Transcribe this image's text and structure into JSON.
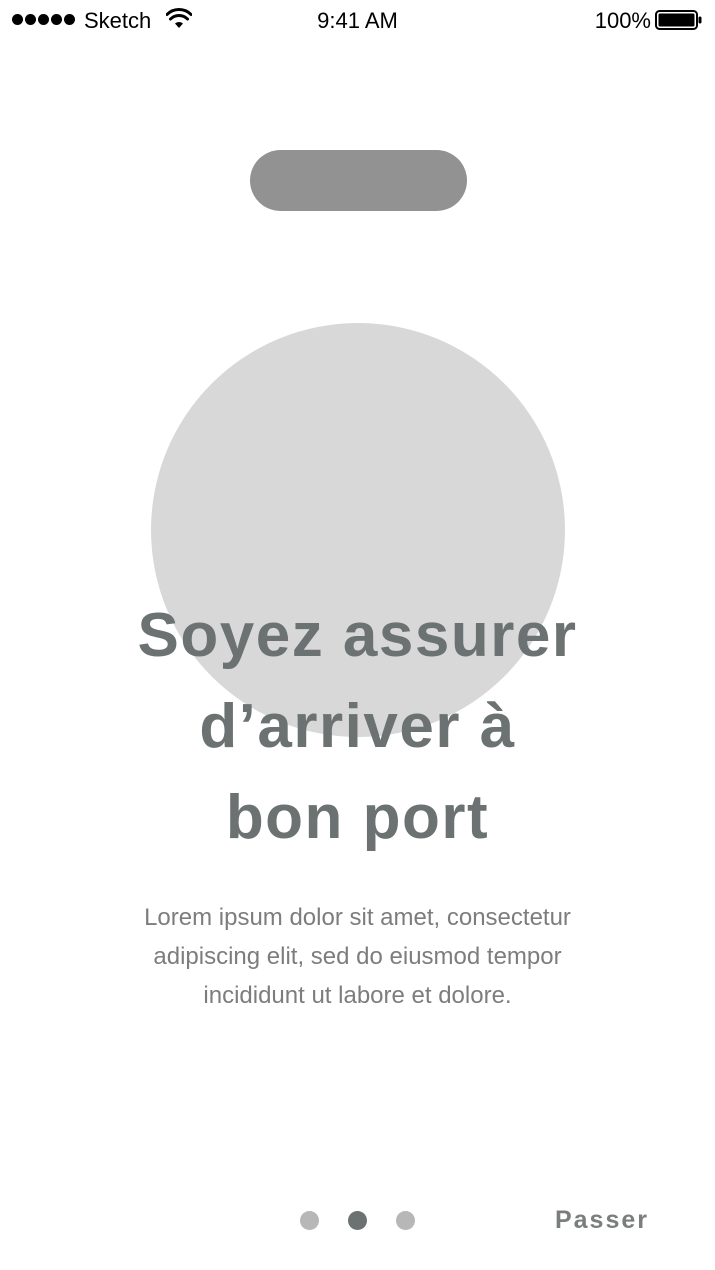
{
  "status_bar": {
    "carrier": "Sketch",
    "time": "9:41 AM",
    "battery": "100%",
    "signal_icon": "signal-dots-icon",
    "wifi_icon": "wifi-icon",
    "battery_icon": "battery-icon"
  },
  "onboarding": {
    "title_lines": [
      "Soyez assurer",
      "d’arriver à",
      "bon port"
    ],
    "body_lines": [
      "Lorem ipsum dolor sit amet, consectetur",
      "adipiscing elit, sed do eiusmod tempor",
      "incididunt ut labore et dolore."
    ],
    "pager": {
      "count": 3,
      "active_index": 1
    },
    "skip_label": "Passer"
  },
  "colors": {
    "pill": "#929292",
    "circle": "#d8d8d8",
    "title": "#6b7271",
    "body": "#7d7d7d",
    "dot_inactive": "#b7b7b7",
    "dot_active": "#6b7271"
  }
}
